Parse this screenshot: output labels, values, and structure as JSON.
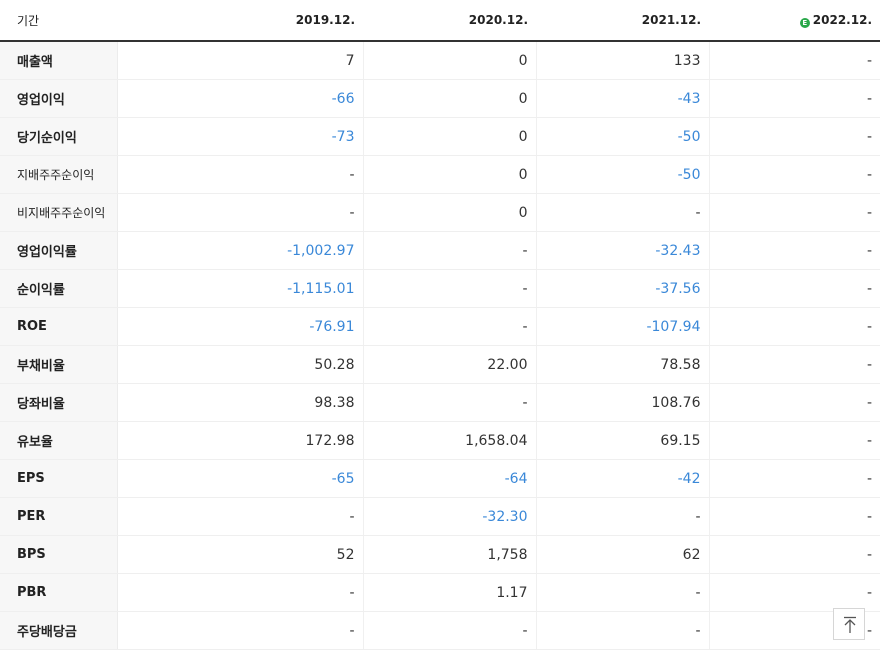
{
  "header": {
    "period_label": "기간",
    "columns": [
      "2019.12.",
      "2020.12.",
      "2021.12.",
      "2022.12."
    ],
    "estimate_badge": "E"
  },
  "rows": [
    {
      "label": "매출액",
      "values": [
        "7",
        "0",
        "133",
        "-"
      ]
    },
    {
      "label": "영업이익",
      "values": [
        "-66",
        "0",
        "-43",
        "-"
      ]
    },
    {
      "label": "당기순이익",
      "values": [
        "-73",
        "0",
        "-50",
        "-"
      ]
    },
    {
      "label": "지배주주순이익",
      "values": [
        "-",
        "0",
        "-50",
        "-"
      ]
    },
    {
      "label": "비지배주주순이익",
      "values": [
        "-",
        "0",
        "-",
        "-"
      ]
    },
    {
      "label": "영업이익률",
      "values": [
        "-1,002.97",
        "-",
        "-32.43",
        "-"
      ]
    },
    {
      "label": "순이익률",
      "values": [
        "-1,115.01",
        "-",
        "-37.56",
        "-"
      ]
    },
    {
      "label": "ROE",
      "values": [
        "-76.91",
        "-",
        "-107.94",
        "-"
      ]
    },
    {
      "label": "부채비율",
      "values": [
        "50.28",
        "22.00",
        "78.58",
        "-"
      ]
    },
    {
      "label": "당좌비율",
      "values": [
        "98.38",
        "-",
        "108.76",
        "-"
      ]
    },
    {
      "label": "유보율",
      "values": [
        "172.98",
        "1,658.04",
        "69.15",
        "-"
      ]
    },
    {
      "label": "EPS",
      "values": [
        "-65",
        "-64",
        "-42",
        "-"
      ]
    },
    {
      "label": "PER",
      "values": [
        "-",
        "-32.30",
        "-",
        "-"
      ]
    },
    {
      "label": "BPS",
      "values": [
        "52",
        "1,758",
        "62",
        "-"
      ]
    },
    {
      "label": "PBR",
      "values": [
        "-",
        "1.17",
        "-",
        "-"
      ]
    },
    {
      "label": "주당배당금",
      "values": [
        "-",
        "-",
        "-",
        "-"
      ]
    }
  ],
  "colors": {
    "negative": "#3a88d8",
    "estimate_badge": "#2aa84a"
  },
  "scroll_top_icon": "arrow-up-to-top-icon"
}
